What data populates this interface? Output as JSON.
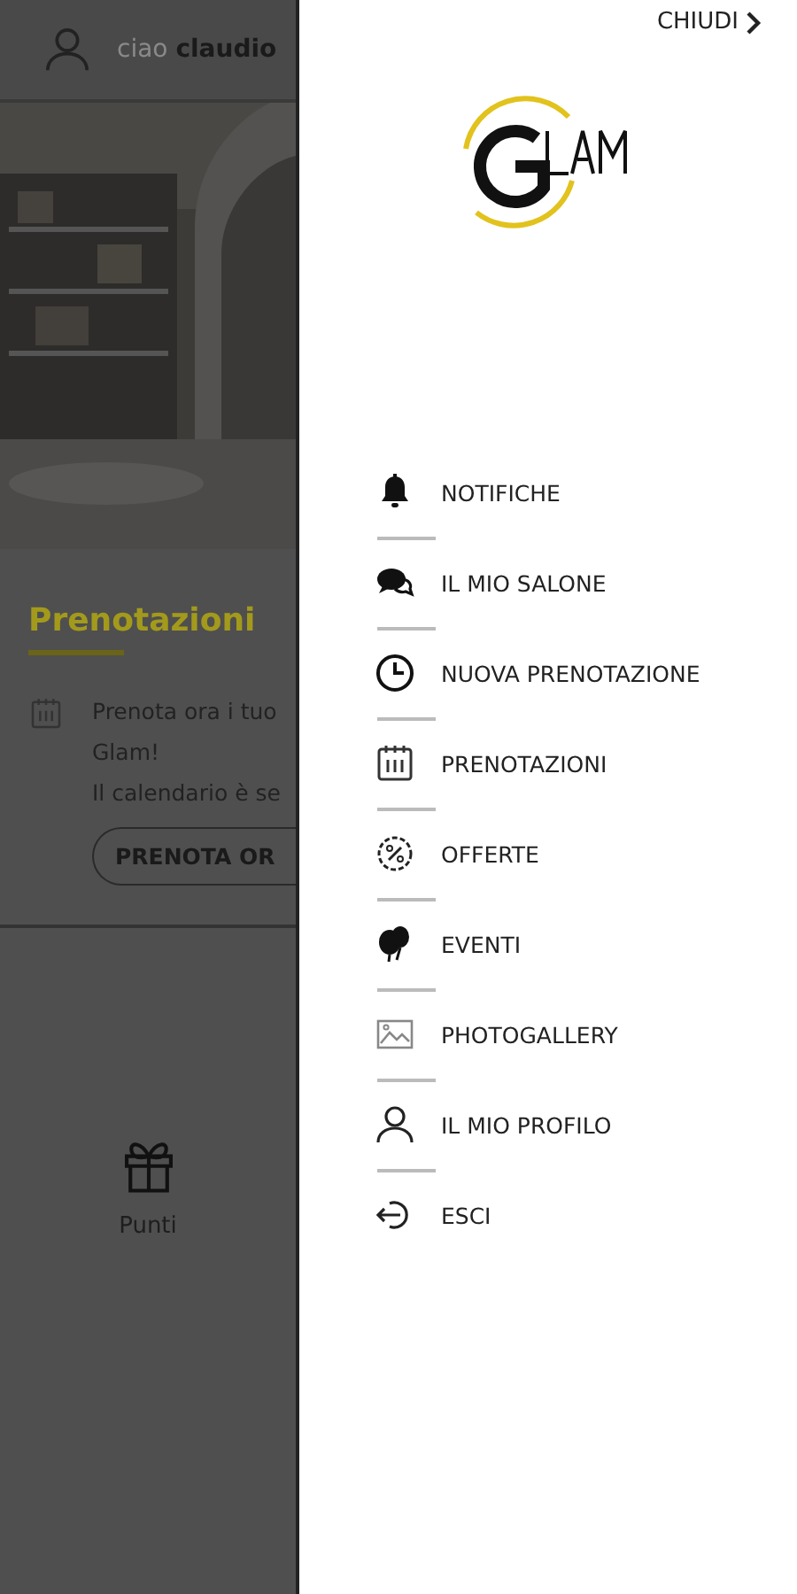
{
  "header": {
    "greeting": "ciao",
    "user_name": "claudio"
  },
  "bookings_card": {
    "title": "Prenotazioni",
    "lines": [
      "Prenota ora i tuo",
      "Glam!",
      "Il calendario è se"
    ],
    "button": "PRENOTA OR"
  },
  "points": {
    "label": "Punti"
  },
  "drawer": {
    "close": "CHIUDI",
    "menu": [
      {
        "label": "NOTIFICHE"
      },
      {
        "label": "IL MIO SALONE"
      },
      {
        "label": "NUOVA PRENOTAZIONE"
      },
      {
        "label": "PRENOTAZIONI"
      },
      {
        "label": "OFFERTE"
      },
      {
        "label": "EVENTI"
      },
      {
        "label": "PHOTOGALLERY"
      },
      {
        "label": "IL MIO PROFILO"
      },
      {
        "label": "ESCI"
      }
    ]
  }
}
